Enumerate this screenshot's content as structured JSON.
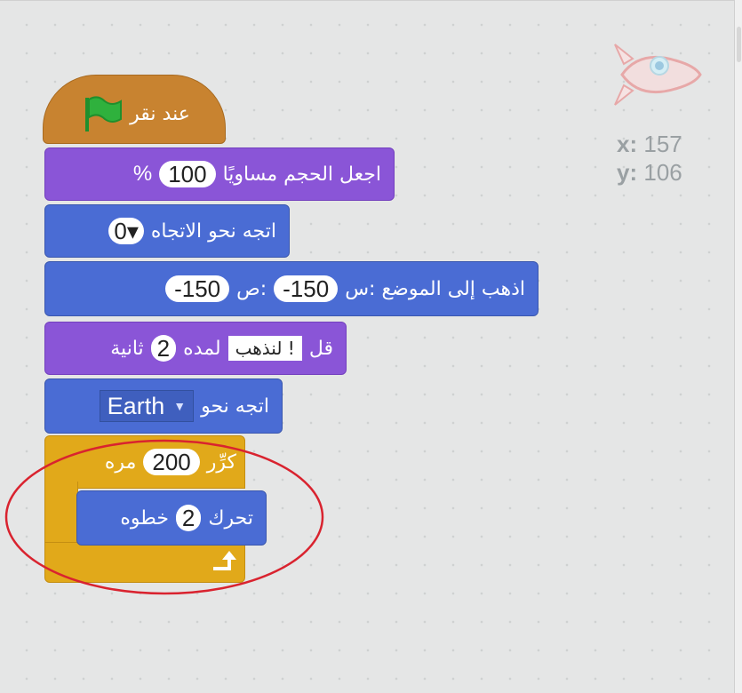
{
  "sprite": {
    "icon": "rocket-sprite-icon",
    "x_label": "x:",
    "x_value": "157",
    "y_label": "y:",
    "y_value": "106"
  },
  "blocks": {
    "when_flag": {
      "text": "عند نقر",
      "icon": "green-flag-icon"
    },
    "set_size": {
      "text": "اجعل الحجم مساويًا",
      "value": "100",
      "unit": "%"
    },
    "point_direction": {
      "text": "اتجه نحو الاتجاه",
      "value": "0▾"
    },
    "go_to": {
      "text": "اذهب إلى الموضع :س",
      "x_value": "-150",
      "y_label": ":ص",
      "y_value": "-150"
    },
    "say": {
      "text": "قل",
      "message": "! لنذهب",
      "for_label": "لمده",
      "secs": "2",
      "secs_label": "ثانية"
    },
    "point_towards": {
      "text": "اتجه نحو",
      "target": "Earth"
    },
    "repeat": {
      "text": "كرِّر",
      "count": "200",
      "unit": "مره",
      "loop_icon": "loop-arrow-icon"
    },
    "move": {
      "text": "تحرك",
      "steps": "2",
      "unit": "خطوه"
    }
  },
  "colors": {
    "looks": "#8a55d7",
    "motion": "#4a6cd4",
    "control": "#e1a91a",
    "events": "#c88330",
    "highlight": "#d9232f"
  }
}
